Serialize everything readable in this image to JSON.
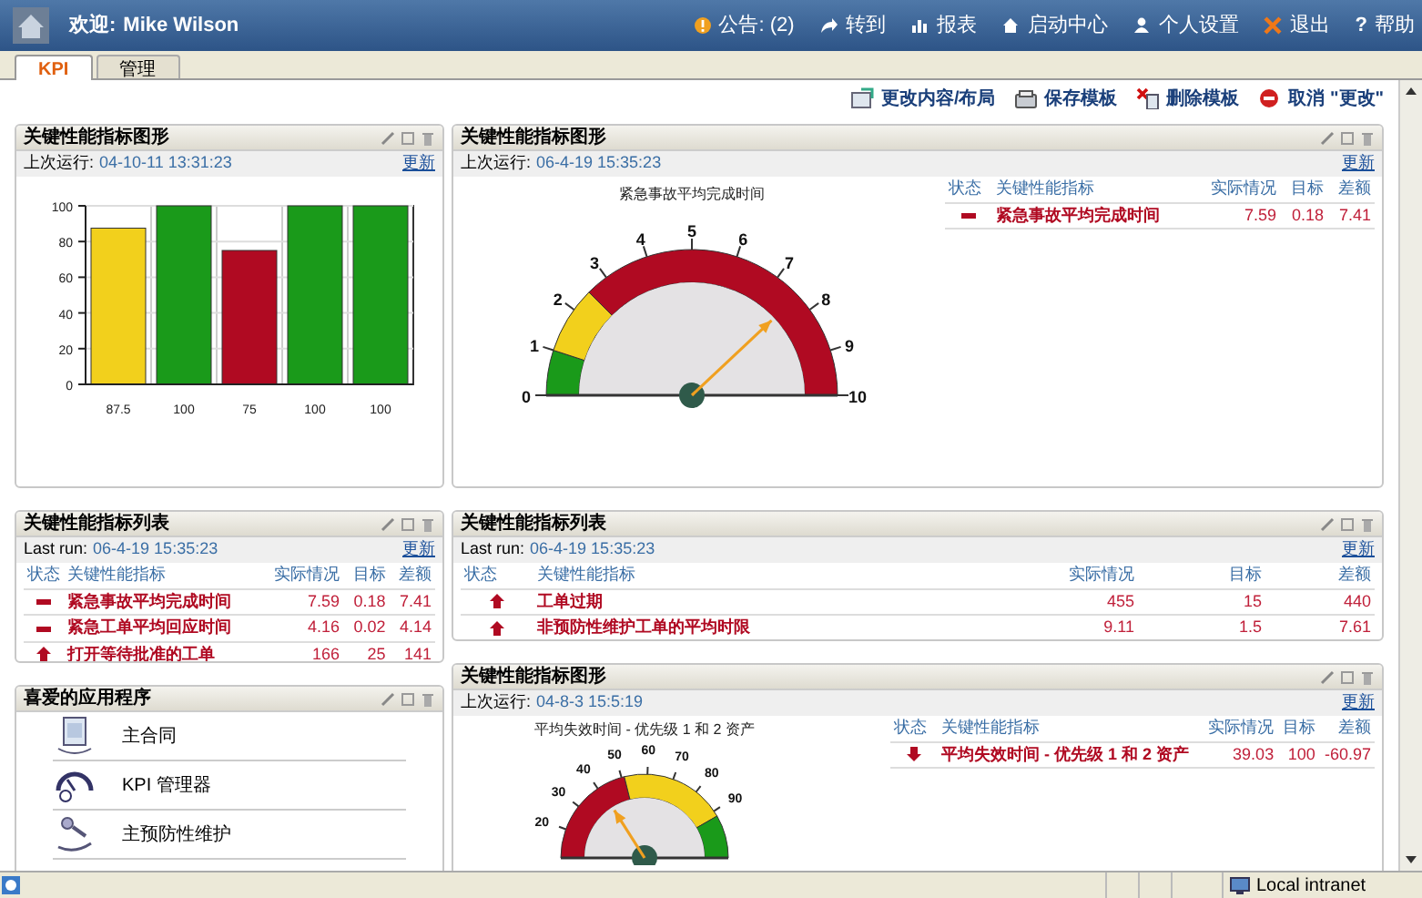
{
  "header": {
    "greeting": "欢迎:",
    "user": "Mike Wilson",
    "links": [
      {
        "kind": "notice",
        "label": "公告: (2)"
      },
      {
        "kind": "goto",
        "label": "转到"
      },
      {
        "kind": "reports",
        "label": "报表"
      },
      {
        "kind": "home",
        "label": "启动中心"
      },
      {
        "kind": "profile",
        "label": "个人设置"
      },
      {
        "kind": "signout",
        "label": "退出"
      },
      {
        "kind": "help",
        "icon": "?",
        "label": "帮助"
      }
    ]
  },
  "tabs": [
    {
      "label": "KPI",
      "selected": true
    },
    {
      "label": "管理",
      "selected": false
    }
  ],
  "toolbar": [
    {
      "kind": "layout",
      "label": "更改内容/布局"
    },
    {
      "kind": "save",
      "label": "保存模板"
    },
    {
      "kind": "delete",
      "label": "删除模板"
    },
    {
      "kind": "cancel",
      "label": "取消 \"更改\""
    }
  ],
  "left_column": [
    {
      "kind": "bar_chart",
      "title": "关键性能指标图形",
      "run_label": "上次运行:",
      "run_time": "04-10-11 13:31:23",
      "refresh": "更新",
      "chart_data": {
        "type": "bar",
        "categories": [
          "87.5",
          "100",
          "75",
          "100",
          "100"
        ],
        "grid": true,
        "ylim": [
          0,
          100
        ],
        "yticks": [
          0,
          20,
          40,
          60,
          80,
          100
        ],
        "series": [
          {
            "color": "#f2d01c",
            "values": [
              87.5,
              null,
              null,
              null,
              null
            ]
          },
          {
            "color": "#1a9a1a",
            "values": [
              null,
              100,
              null,
              100,
              100
            ]
          },
          {
            "color": "#b00a22",
            "values": [
              null,
              null,
              75,
              null,
              null
            ]
          }
        ]
      }
    },
    {
      "kind": "list",
      "title": "关键性能指标列表",
      "run_label": "Last run:",
      "run_time": "06-4-19 15:35:23",
      "refresh": "更新",
      "columns": [
        "状态",
        "关键性能指标",
        "实际情况",
        "目标",
        "差额"
      ],
      "rows": [
        {
          "kind": "minus",
          "kpi": "紧急事故平均完成时间",
          "actual": "7.59",
          "target": "0.18",
          "variance": "7.41"
        },
        {
          "kind": "minus",
          "kpi": "紧急工单平均回应时间",
          "actual": "4.16",
          "target": "0.02",
          "variance": "4.14"
        },
        {
          "kind": "up",
          "kpi": "打开等待批准的工单",
          "actual": "166",
          "target": "25",
          "variance": "141"
        }
      ]
    },
    {
      "kind": "favorites",
      "title": "喜爱的应用程序",
      "items": [
        {
          "kind": "document",
          "label": "主合同"
        },
        {
          "kind": "dial",
          "label": "KPI 管理器"
        },
        {
          "kind": "tool",
          "label": "主预防性维护"
        }
      ]
    }
  ],
  "right_column": [
    {
      "kind": "gauge",
      "title": "关键性能指标图形",
      "run_label": "上次运行:",
      "run_time": "06-4-19 15:35:23",
      "refresh": "更新",
      "gauge": {
        "title": "紧急事故平均完成时间",
        "ticks": [
          "0",
          "1",
          "2",
          "3",
          "4",
          "5",
          "6",
          "7",
          "8",
          "9",
          "10"
        ],
        "level": 0.76
      },
      "columns": [
        "状态",
        "关键性能指标",
        "实际情况",
        "目标",
        "差额"
      ],
      "rows": [
        {
          "kind": "minus",
          "kpi": "紧急事故平均完成时间",
          "actual": "7.59",
          "target": "0.18",
          "variance": "7.41"
        }
      ]
    },
    {
      "kind": "list",
      "title": "关键性能指标列表",
      "run_label": "Last run:",
      "run_time": "06-4-19 15:35:23",
      "refresh": "更新",
      "columns": [
        "状态",
        "关键性能指标",
        "实际情况",
        "目标",
        "差额"
      ],
      "rows": [
        {
          "kind": "up",
          "kpi": "工单过期",
          "actual": "455",
          "target": "15",
          "variance": "440"
        },
        {
          "kind": "up",
          "kpi": "非预防性维护工单的平均时限",
          "actual": "9.11",
          "target": "1.5",
          "variance": "7.61"
        }
      ]
    },
    {
      "kind": "gauge",
      "title": "关键性能指标图形",
      "run_label": "上次运行:",
      "run_time": "04-8-3 15:5:19",
      "refresh": "更新",
      "gauge": {
        "title": "平均失效时间 - 优先级 1 和 2 资产",
        "ticks": [
          "20",
          "30",
          "40",
          "50",
          "60",
          "70",
          "80",
          "90"
        ],
        "level": 0.32
      },
      "columns": [
        "状态",
        "关键性能指标",
        "实际情况",
        "目标",
        "差额"
      ],
      "rows": [
        {
          "kind": "down",
          "kpi": "平均失效时间 - 优先级 1 和 2 资产",
          "actual": "39.03",
          "target": "100",
          "variance": "-60.97"
        }
      ]
    }
  ],
  "status_bar": {
    "zone": "Local intranet"
  }
}
